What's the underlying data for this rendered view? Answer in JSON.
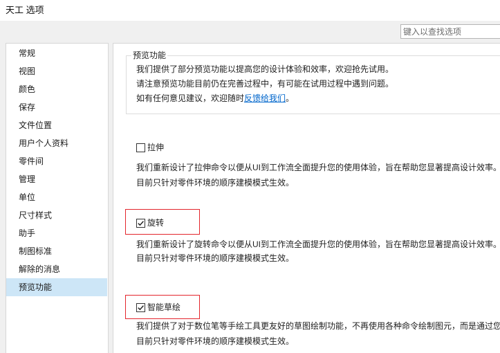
{
  "window": {
    "title": "天工 选项"
  },
  "search": {
    "placeholder": "键入以查找选项",
    "value": ""
  },
  "sidebar": {
    "items": [
      {
        "label": "常规",
        "selected": false
      },
      {
        "label": "视图",
        "selected": false
      },
      {
        "label": "颜色",
        "selected": false
      },
      {
        "label": "保存",
        "selected": false
      },
      {
        "label": "文件位置",
        "selected": false
      },
      {
        "label": "用户个人资料",
        "selected": false
      },
      {
        "label": "零件间",
        "selected": false
      },
      {
        "label": "管理",
        "selected": false
      },
      {
        "label": "单位",
        "selected": false
      },
      {
        "label": "尺寸样式",
        "selected": false
      },
      {
        "label": "助手",
        "selected": false
      },
      {
        "label": "制图标准",
        "selected": false
      },
      {
        "label": "解除的消息",
        "selected": false
      },
      {
        "label": "预览功能",
        "selected": true
      }
    ]
  },
  "preview": {
    "legend": "预览功能",
    "intro": [
      "我们提供了部分预览功能以提高您的设计体验和效率，欢迎抢先试用。",
      "请注意预览功能目前仍在完善过程中，有可能在试用过程中遇到问题。"
    ],
    "feedback": {
      "prefix": "如有任何意见建议，欢迎随时",
      "link": "反馈给我们",
      "suffix": "。"
    },
    "features": [
      {
        "label": "拉伸",
        "checked": false,
        "annotated": false,
        "desc": [
          "我们重新设计了拉伸命令以便从UI到工作流全面提升您的使用体验，旨在帮助您显著提高设计效率。",
          "目前只针对零件环境的顺序建模模式生效。"
        ]
      },
      {
        "label": "旋转",
        "checked": true,
        "annotated": true,
        "desc": [
          "我们重新设计了旋转命令以便从UI到工作流全面提升您的使用体验，旨在帮助您显著提高设计效率。",
          "目前只针对零件环境的顺序建模模式生效。"
        ]
      },
      {
        "label": "智能草绘",
        "checked": true,
        "annotated": true,
        "desc": [
          "我们提供了对于数位笔等手绘工具更友好的草图绘制功能，不再使用各种命令绘制图元，而是通过您",
          "目前只针对零件环境的顺序建模模式生效。"
        ]
      }
    ]
  },
  "colors": {
    "link": "#0066cc",
    "selection": "#cde6f7",
    "annotation": "#e3242b"
  }
}
